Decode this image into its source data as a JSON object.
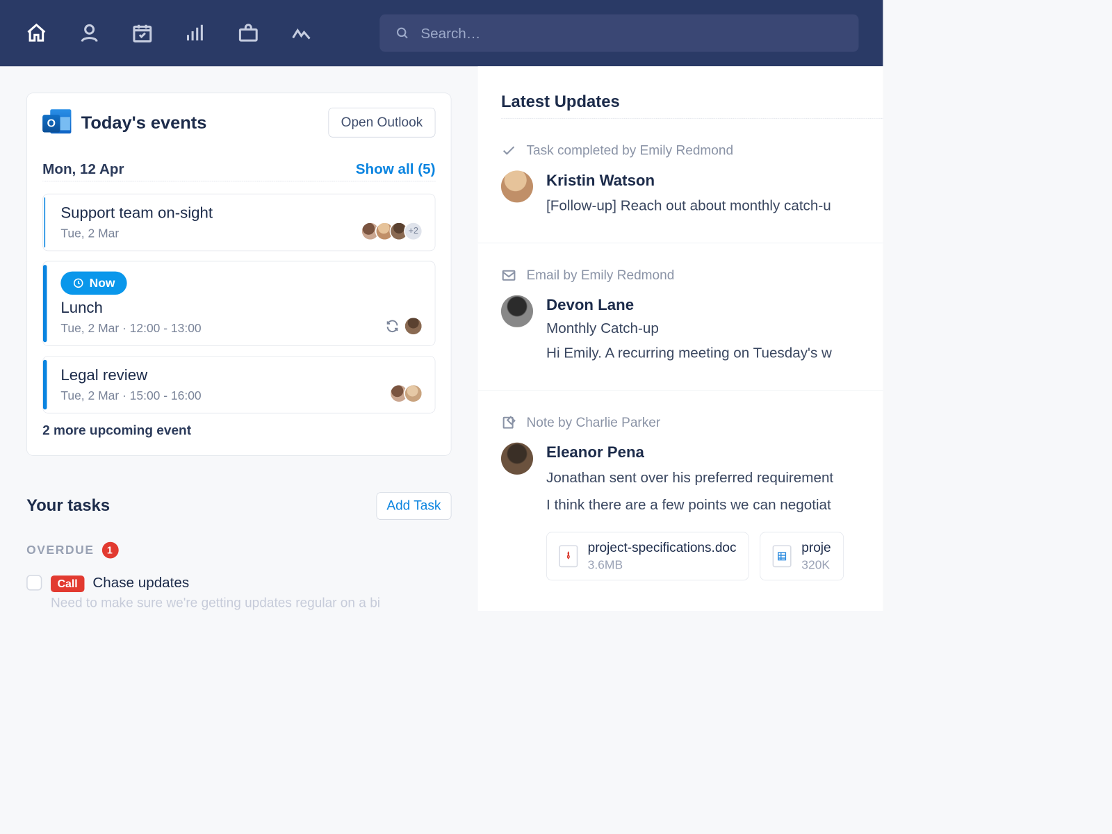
{
  "nav": {
    "items": [
      "home",
      "contacts",
      "calendar",
      "reports",
      "deals",
      "activity"
    ],
    "active": "home"
  },
  "search": {
    "placeholder": "Search…"
  },
  "events_card": {
    "title": "Today's events",
    "open_outlook": "Open Outlook",
    "date": "Mon, 12 Apr",
    "show_all": "Show all (5)",
    "more_text": "2 more upcoming event",
    "items": [
      {
        "title": "Support team on-sight",
        "meta": "Tue, 2 Mar",
        "attendees_extra": "+2"
      },
      {
        "now_label": "Now",
        "title": "Lunch",
        "meta": "Tue, 2 Mar · 12:00 - 13:00"
      },
      {
        "title": "Legal review",
        "meta": "Tue, 2 Mar · 15:00 - 16:00"
      }
    ]
  },
  "tasks": {
    "title": "Your tasks",
    "add_label": "Add Task",
    "overdue_label": "OVERDUE",
    "overdue_count": "1",
    "items": [
      {
        "badge": "Call",
        "title": "Chase updates",
        "desc": "Need to make sure we're getting updates regular on a bi"
      }
    ]
  },
  "updates": {
    "title": "Latest Updates",
    "items": [
      {
        "kind": "task",
        "header": "Task completed by Emily Redmond",
        "name": "Kristin Watson",
        "lines": [
          "[Follow-up] Reach out about monthly catch-u"
        ]
      },
      {
        "kind": "email",
        "header": "Email by Emily Redmond",
        "name": "Devon Lane",
        "subject": "Monthly Catch-up",
        "lines": [
          "Hi Emily. A recurring meeting on Tuesday's w"
        ]
      },
      {
        "kind": "note",
        "header": "Note by Charlie Parker",
        "name": "Eleanor Pena",
        "lines": [
          "Jonathan sent over his preferred requirement",
          "I think there are a few points we can negotiat"
        ],
        "attachments": [
          {
            "name": "project-specifications.doc",
            "size": "3.6MB",
            "type": "pdf"
          },
          {
            "name": "proje",
            "size": "320K",
            "type": "sheet"
          }
        ]
      }
    ]
  }
}
